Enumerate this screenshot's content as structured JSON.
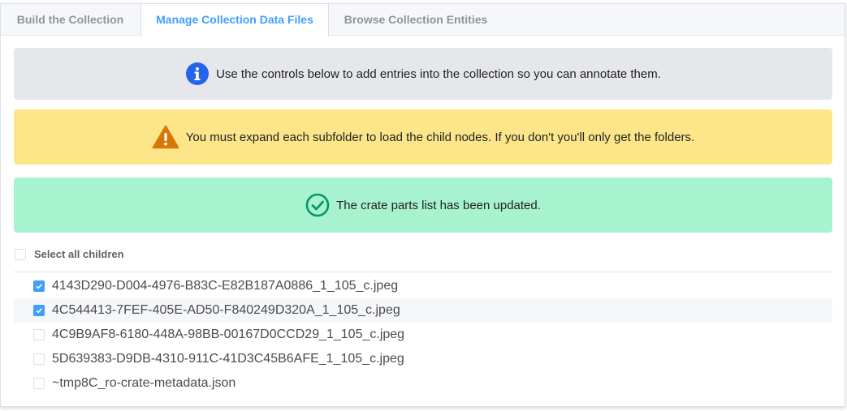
{
  "tabs": [
    {
      "label": "Build the Collection",
      "active": false
    },
    {
      "label": "Manage Collection Data Files",
      "active": true
    },
    {
      "label": "Browse Collection Entities",
      "active": false
    }
  ],
  "alerts": {
    "info": {
      "text": "Use the controls below to add entries into the collection so you can annotate them.",
      "icon": "info-circle-icon",
      "color": "#2563eb"
    },
    "warning": {
      "text": "You must expand each subfolder to load the child nodes. If you don't you'll only get the folders.",
      "icon": "warning-triangle-icon",
      "color": "#d97706"
    },
    "success": {
      "text": "The crate parts list has been updated.",
      "icon": "check-circle-icon",
      "color": "#059669"
    }
  },
  "select_all": {
    "label": "Select all children",
    "checked": false
  },
  "files": [
    {
      "name": "4143D290-D004-4976-B83C-E82B187A0886_1_105_c.jpeg",
      "checked": true
    },
    {
      "name": "4C544413-7FEF-405E-AD50-F840249D320A_1_105_c.jpeg",
      "checked": true
    },
    {
      "name": "4C9B9AF8-6180-448A-98BB-00167D0CCD29_1_105_c.jpeg",
      "checked": false
    },
    {
      "name": "5D639383-D9DB-4310-911C-41D3C45B6AFE_1_105_c.jpeg",
      "checked": false
    },
    {
      "name": "~tmp8C_ro-crate-metadata.json",
      "checked": false
    }
  ],
  "colors": {
    "accent": "#409eff",
    "info_bg": "#e5e7eb",
    "warning_bg": "#fde68a",
    "success_bg": "#a7f3d0"
  }
}
